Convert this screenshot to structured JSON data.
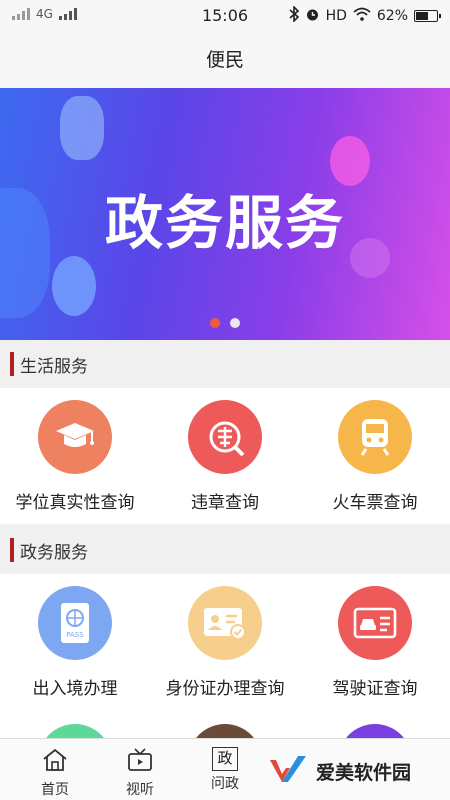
{
  "status": {
    "network": "4G",
    "time": "15:06",
    "hd": "HD",
    "battery": "62%",
    "battery_level": 0.62
  },
  "nav": {
    "title": "便民"
  },
  "banner": {
    "title": "政务服务",
    "slide_count": 2,
    "active_slide": 1
  },
  "life_section": {
    "title": "生活服务",
    "items": [
      {
        "label": "学位真实性查询",
        "icon": "graduation-cap-icon",
        "color": "#ee8160"
      },
      {
        "label": "违章查询",
        "icon": "traffic-violation-icon",
        "color": "#ee5a5a"
      },
      {
        "label": "火车票查询",
        "icon": "train-icon",
        "color": "#f7b64a"
      }
    ]
  },
  "gov_section": {
    "title": "政务服务",
    "items": [
      {
        "label": "出入境办理",
        "icon": "passport-icon",
        "color": "#7ea7f2"
      },
      {
        "label": "身份证办理查询",
        "icon": "id-card-icon",
        "color": "#f6cf8c"
      },
      {
        "label": "驾驶证查询",
        "icon": "driver-license-icon",
        "color": "#ee5a5a"
      }
    ]
  },
  "tabs": [
    {
      "label": "首页",
      "icon": "home-icon"
    },
    {
      "label": "视听",
      "icon": "tv-icon"
    },
    {
      "label": "问政",
      "icon": "gov-icon",
      "icon_text": "政"
    }
  ],
  "watermark": {
    "text": "爱美软件园"
  }
}
